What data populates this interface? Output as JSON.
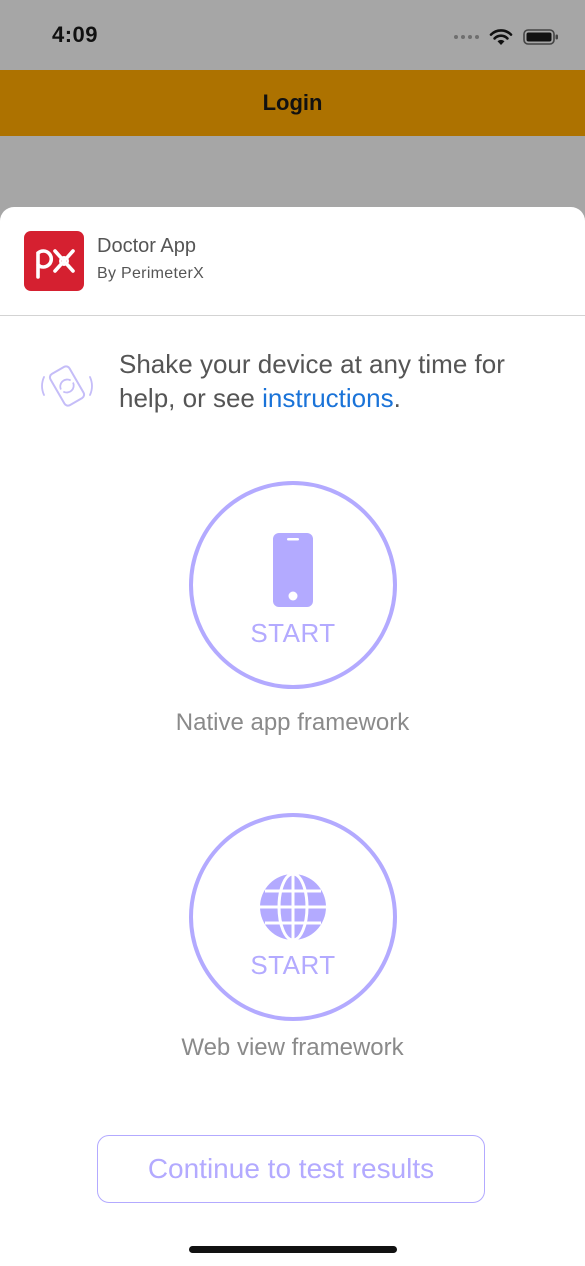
{
  "status_bar": {
    "time": "4:09"
  },
  "nav": {
    "title": "Login"
  },
  "app": {
    "name": "Doctor App",
    "author": "By PerimeterX",
    "logo_icon": "perimeterx-logo-icon",
    "brand_color": "#d52030"
  },
  "hint": {
    "text_before_link": "Shake your device at any time for help, or see ",
    "link": "instructions",
    "text_after_link": ".",
    "icon": "shake-device-icon"
  },
  "native": {
    "start_label": "START",
    "caption": "Native app framework",
    "icon": "phone-icon"
  },
  "web": {
    "start_label": "START",
    "caption": "Web view framework",
    "icon": "globe-icon"
  },
  "continue_button": {
    "label": "Continue to test results"
  },
  "colors": {
    "accent": "#b3aaff",
    "nav_background": "#ad7200",
    "link": "#1a73d8"
  }
}
